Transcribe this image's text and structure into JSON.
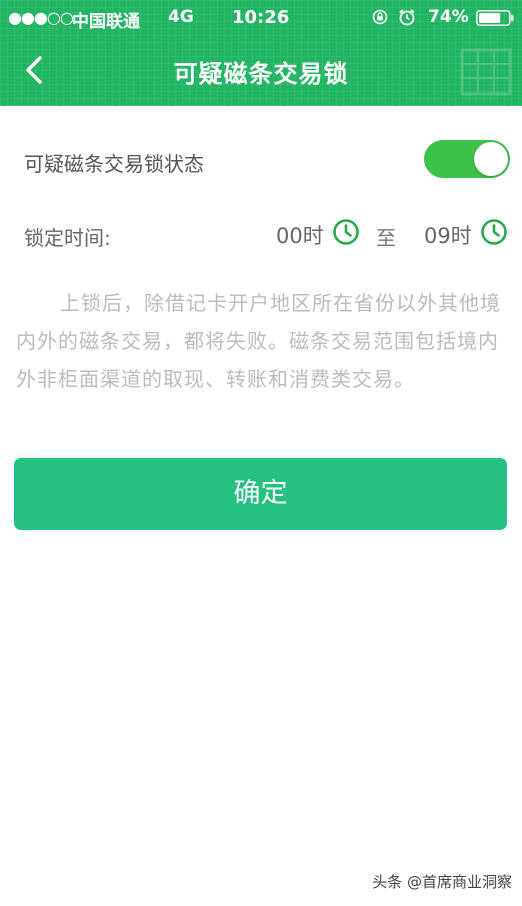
{
  "status_bar": {
    "signal": "●●●○○",
    "carrier": "中国联通",
    "network": "4G",
    "time": "10:26",
    "battery_percent": "74%",
    "battery_level": 0.74
  },
  "nav": {
    "title": "可疑磁条交易锁",
    "back_icon": "chevron-left-icon"
  },
  "lock_status": {
    "label": "可疑磁条交易锁状态",
    "enabled": true
  },
  "lock_time": {
    "label": "锁定时间:",
    "start": "00时",
    "separator": "至",
    "end": "09时"
  },
  "description": "上锁后，除借记卡开户地区所在省份以外其他境内外的磁条交易，都将失败。磁条交易范围包括境内外非柜面渠道的取现、转账和消费类交易。",
  "confirm_label": "确定",
  "watermark": "头条 @首席商业洞察",
  "colors": {
    "header": "#21b463",
    "toggle_on": "#3cc24a",
    "button": "#24c183",
    "clock_icon": "#2aa84a"
  }
}
